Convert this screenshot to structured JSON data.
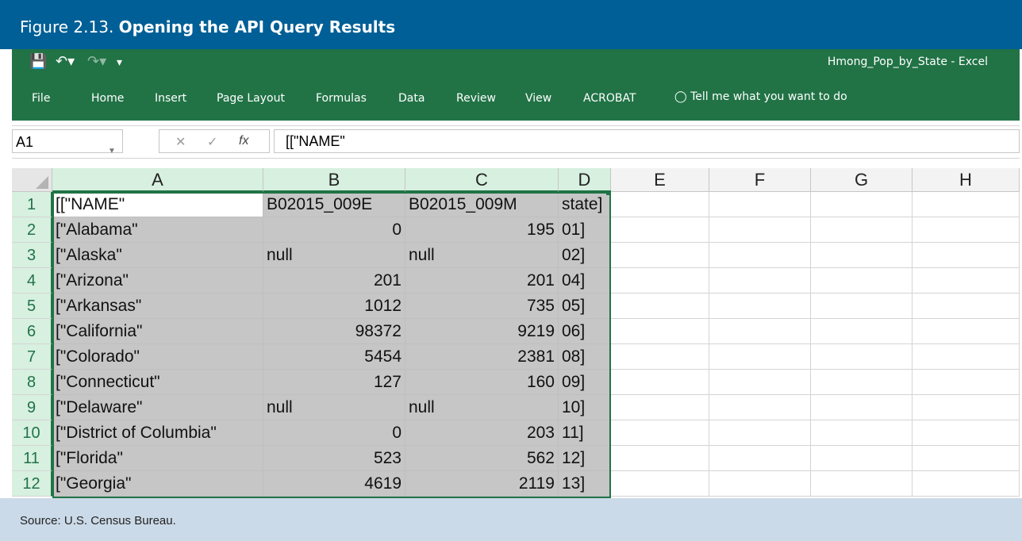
{
  "figure": {
    "label": "Figure 2.13.",
    "title": "Opening the API Query Results",
    "source": "Source: U.S. Census Bureau."
  },
  "window": {
    "title": "Hmong_Pop_by_State - Excel"
  },
  "ribbon": {
    "tabs": [
      "File",
      "Home",
      "Insert",
      "Page Layout",
      "Formulas",
      "Data",
      "Review",
      "View",
      "ACROBAT"
    ],
    "tell_me": "Tell me what you want to do"
  },
  "formula_bar": {
    "name_box": "A1",
    "fx": "fx",
    "value": "[[\"NAME\""
  },
  "sheet": {
    "columns": [
      "A",
      "B",
      "C",
      "D",
      "E",
      "F",
      "G",
      "H"
    ],
    "rows": [
      {
        "n": "1",
        "A": "[[\"NAME\"",
        "B": "B02015_009E",
        "C": "B02015_009M",
        "D": "state]"
      },
      {
        "n": "2",
        "A": "[\"Alabama\"",
        "B": "0",
        "C": "195",
        "D": "01]"
      },
      {
        "n": "3",
        "A": "[\"Alaska\"",
        "B": "null",
        "C": "null",
        "D": "02]"
      },
      {
        "n": "4",
        "A": "[\"Arizona\"",
        "B": "201",
        "C": "201",
        "D": "04]"
      },
      {
        "n": "5",
        "A": "[\"Arkansas\"",
        "B": "1012",
        "C": "735",
        "D": "05]"
      },
      {
        "n": "6",
        "A": "[\"California\"",
        "B": "98372",
        "C": "9219",
        "D": "06]"
      },
      {
        "n": "7",
        "A": "[\"Colorado\"",
        "B": "5454",
        "C": "2381",
        "D": "08]"
      },
      {
        "n": "8",
        "A": "[\"Connecticut\"",
        "B": "127",
        "C": "160",
        "D": "09]"
      },
      {
        "n": "9",
        "A": "[\"Delaware\"",
        "B": "null",
        "C": "null",
        "D": "10]"
      },
      {
        "n": "10",
        "A": "[\"District of Columbia\"",
        "B": "0",
        "C": "203",
        "D": "11]"
      },
      {
        "n": "11",
        "A": "[\"Florida\"",
        "B": "523",
        "C": "562",
        "D": "12]"
      },
      {
        "n": "12",
        "A": "[\"Georgia\"",
        "B": "4619",
        "C": "2119",
        "D": "13]"
      }
    ]
  },
  "colors": {
    "figure_header": "#005f96",
    "excel_green": "#217346",
    "selection_fill": "#c6c6c6",
    "footer": "#cbdae8"
  }
}
